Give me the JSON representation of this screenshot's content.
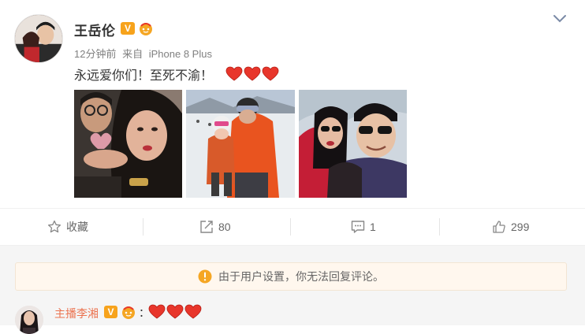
{
  "post": {
    "username": "王岳伦",
    "verified_badge": "V",
    "time": "12分钟前",
    "source_prefix": "来自",
    "source": "iPhone 8 Plus",
    "text": "永远爱你们！至死不渝！",
    "heart_emoji_count": 3,
    "photos": [
      {
        "name": "photo-couple-closeup"
      },
      {
        "name": "photo-ski-family"
      },
      {
        "name": "photo-selfie-sunglasses"
      }
    ]
  },
  "actions": {
    "favorite_label": "收藏",
    "repost_count": "80",
    "comment_count": "1",
    "like_count": "299"
  },
  "notice": {
    "text": "由于用户设置，你无法回复评论。"
  },
  "comment": {
    "author": "主播李湘",
    "verified_badge": "V",
    "colon": "：",
    "heart_emoji_count": 3
  },
  "colors": {
    "verified_orange": "#f7a31c",
    "comment_author": "#eb7350",
    "heart_red": "#e8362b",
    "notice_bg": "#fff7ee",
    "notice_icon": "#f5a623"
  },
  "icons": [
    "chevron-down-icon",
    "star-icon",
    "repost-icon",
    "comment-icon",
    "thumbs-up-icon",
    "warning-icon",
    "heart-emoji-icon",
    "fan-badge-icon"
  ]
}
